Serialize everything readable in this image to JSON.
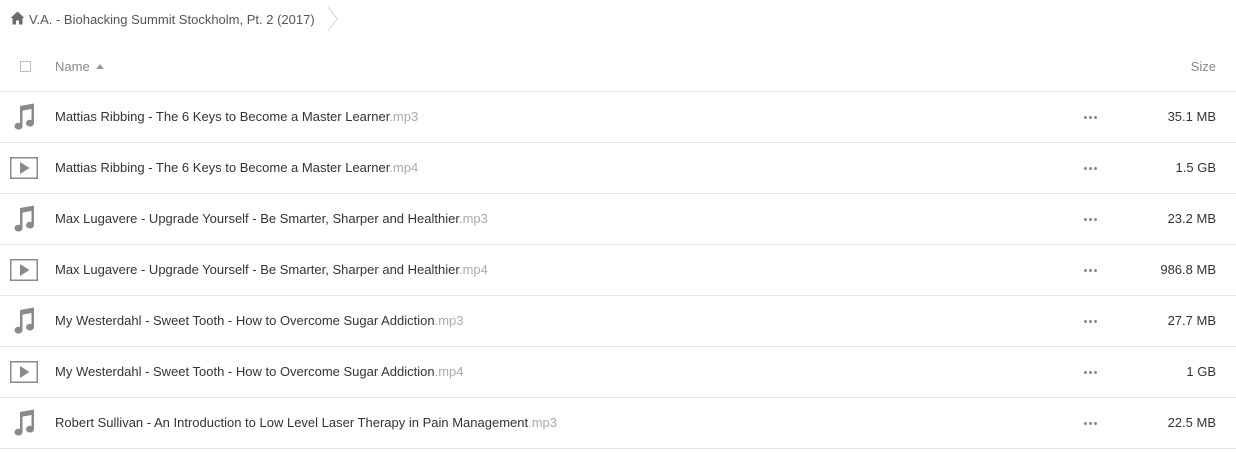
{
  "breadcrumb": {
    "home_icon": "home-icon",
    "title": "V.A. - Biohacking Summit Stockholm, Pt. 2 (2017)"
  },
  "header": {
    "name_label": "Name",
    "size_label": "Size",
    "sort_icon": "sort-ascending-icon"
  },
  "files": [
    {
      "name": "Mattias Ribbing - The 6 Keys to Become a Master Learner",
      "ext": ".mp3",
      "size": "35.1 MB",
      "icon": "music-note-icon"
    },
    {
      "name": "Mattias Ribbing - The 6 Keys to Become a Master Learner",
      "ext": ".mp4",
      "size": "1.5 GB",
      "icon": "video-play-icon"
    },
    {
      "name": "Max Lugavere - Upgrade Yourself - Be Smarter, Sharper and Healthier",
      "ext": ".mp3",
      "size": "23.2 MB",
      "icon": "music-note-icon"
    },
    {
      "name": "Max Lugavere - Upgrade Yourself - Be Smarter, Sharper and Healthier",
      "ext": ".mp4",
      "size": "986.8 MB",
      "icon": "video-play-icon"
    },
    {
      "name": "My Westerdahl - Sweet Tooth - How to Overcome Sugar Addiction",
      "ext": ".mp3",
      "size": "27.7 MB",
      "icon": "music-note-icon"
    },
    {
      "name": "My Westerdahl - Sweet Tooth - How to Overcome Sugar Addiction",
      "ext": ".mp4",
      "size": "1 GB",
      "icon": "video-play-icon"
    },
    {
      "name": "Robert Sullivan - An Introduction to Low Level Laser Therapy in Pain Management",
      "ext": ".mp3",
      "size": "22.5 MB",
      "icon": "music-note-icon"
    }
  ],
  "colors": {
    "icon_gray": "#8a8a8a",
    "ext_gray": "#aaaaaa",
    "divider": "#e6e6e6"
  }
}
